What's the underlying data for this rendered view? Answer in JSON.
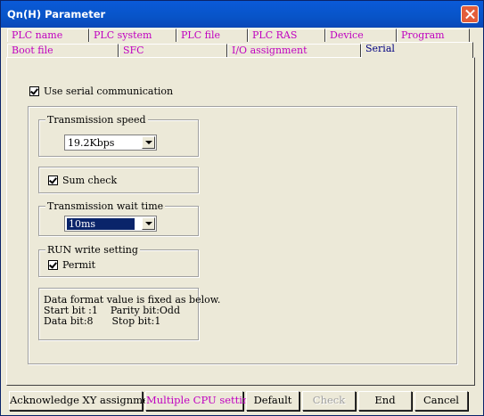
{
  "window": {
    "title": "Qn(H) Parameter"
  },
  "tabs_row1": [
    {
      "label": "PLC name"
    },
    {
      "label": "PLC system"
    },
    {
      "label": "PLC file"
    },
    {
      "label": "PLC RAS"
    },
    {
      "label": "Device"
    },
    {
      "label": "Program"
    }
  ],
  "tabs_row2": [
    {
      "label": "Boot file"
    },
    {
      "label": "SFC"
    },
    {
      "label": "I/O assignment"
    },
    {
      "label": "Serial",
      "selected": true
    }
  ],
  "serial": {
    "use_serial_label": "Use serial communication",
    "use_serial_checked": true,
    "transmission_speed": {
      "legend": "Transmission speed",
      "value": "19.2Kbps"
    },
    "sum_check": {
      "label": "Sum check",
      "checked": true
    },
    "wait_time": {
      "legend": "Transmission wait time",
      "value": "10ms"
    },
    "run_write": {
      "legend": "RUN write setting",
      "permit_label": "Permit",
      "checked": true
    },
    "info": {
      "line1": "Data format value is fixed as below.",
      "line2": "Start bit :1    Parity bit:Odd",
      "line3": "Data bit:8      Stop bit:1"
    }
  },
  "buttons": {
    "ack_xy": "Acknowledge XY assignment",
    "multi_cpu": "Multiple CPU settings",
    "default": "Default",
    "check": "Check",
    "end": "End",
    "cancel": "Cancel"
  },
  "colors": {
    "accent_text": "#c000c0",
    "title_bar": "#0a5ad8",
    "close": "#e35d3a"
  }
}
